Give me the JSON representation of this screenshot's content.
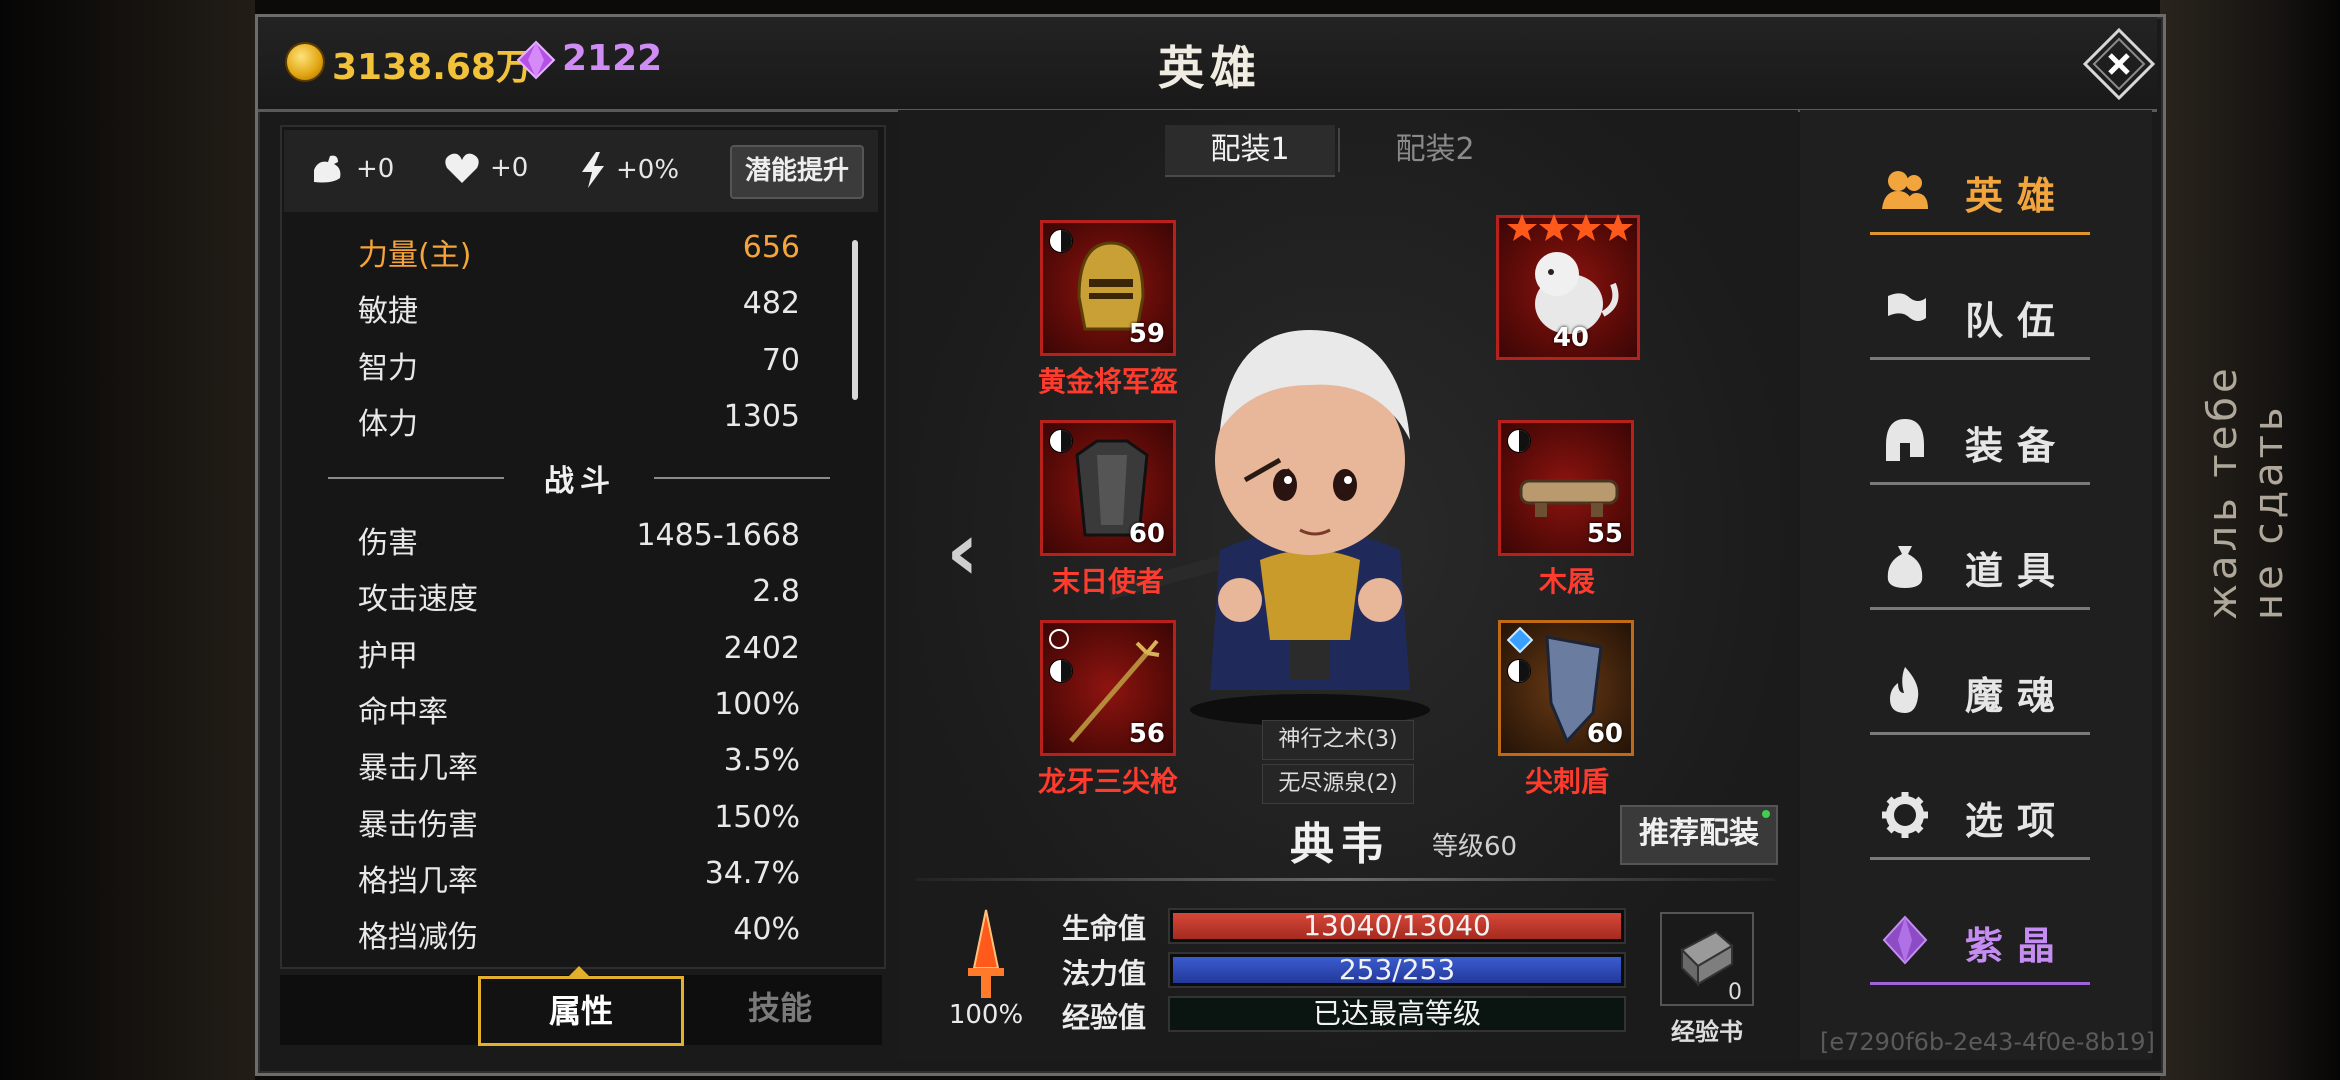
{
  "currency": {
    "gold": "3138.68万",
    "gems": "2122"
  },
  "title": "英雄",
  "potential": {
    "strength_bonus": "+0",
    "health_bonus": "+0",
    "energy_bonus": "+0%",
    "upgrade_button": "潜能提升"
  },
  "base_stats": [
    {
      "label": "力量(主)",
      "value": "656"
    },
    {
      "label": "敏捷",
      "value": "482"
    },
    {
      "label": "智力",
      "value": "70"
    },
    {
      "label": "体力",
      "value": "1305"
    }
  ],
  "combat_title": "战斗",
  "combat_stats": [
    {
      "label": "伤害",
      "value": "1485-1668"
    },
    {
      "label": "攻击速度",
      "value": "2.8"
    },
    {
      "label": "护甲",
      "value": "2402"
    },
    {
      "label": "命中率",
      "value": "100%"
    },
    {
      "label": "暴击几率",
      "value": "3.5%"
    },
    {
      "label": "暴击伤害",
      "value": "150%"
    },
    {
      "label": "格挡几率",
      "value": "34.7%"
    },
    {
      "label": "格挡减伤",
      "value": "40%"
    }
  ],
  "left_tabs": {
    "attributes": "属性",
    "skills": "技能"
  },
  "loadouts": {
    "first": "配装1",
    "second": "配装2"
  },
  "equipment": {
    "helmet": {
      "name": "黄金将军盔",
      "level": "59"
    },
    "armor": {
      "name": "末日使者",
      "level": "60"
    },
    "weapon": {
      "name": "龙牙三尖枪",
      "level": "56"
    },
    "pet": {
      "name": "",
      "level": "40",
      "stars": 4
    },
    "boots": {
      "name": "木屐",
      "level": "55"
    },
    "shield": {
      "name": "尖刺盾",
      "level": "60"
    }
  },
  "set_bonuses": [
    "神行之术(3)",
    "无尽源泉(2)"
  ],
  "hero": {
    "name": "典韦",
    "level": "等级60"
  },
  "recommend_button": "推荐配装",
  "power_percent": "100%",
  "bars": {
    "hp": {
      "label": "生命值",
      "text": "13040/13040",
      "fill": 1.0
    },
    "mp": {
      "label": "法力值",
      "text": "253/253",
      "fill": 1.0
    },
    "xp": {
      "label": "经验值",
      "text": "已达最高等级",
      "fill": 0
    }
  },
  "exp_book": {
    "count": "0",
    "label": "经验书"
  },
  "nav": [
    {
      "label": "英雄",
      "icon": "hero-icon"
    },
    {
      "label": "队伍",
      "icon": "flag-icon"
    },
    {
      "label": "装备",
      "icon": "helmet-icon"
    },
    {
      "label": "道具",
      "icon": "bag-icon"
    },
    {
      "label": "魔魂",
      "icon": "flame-icon"
    },
    {
      "label": "选项",
      "icon": "gear-icon"
    },
    {
      "label": "紫晶",
      "icon": "crystal-icon"
    }
  ],
  "uid": "[e7290f6b-2e43-4f0e-8b19]",
  "side_text": "жаль тебе не сдать",
  "colors": {
    "gold": "#f2c23b",
    "gem": "#d08cf5",
    "accent": "#e0962c",
    "equip_name": "#ff3b2e",
    "hp": "#c73a2c",
    "mp": "#2e4fb8"
  }
}
